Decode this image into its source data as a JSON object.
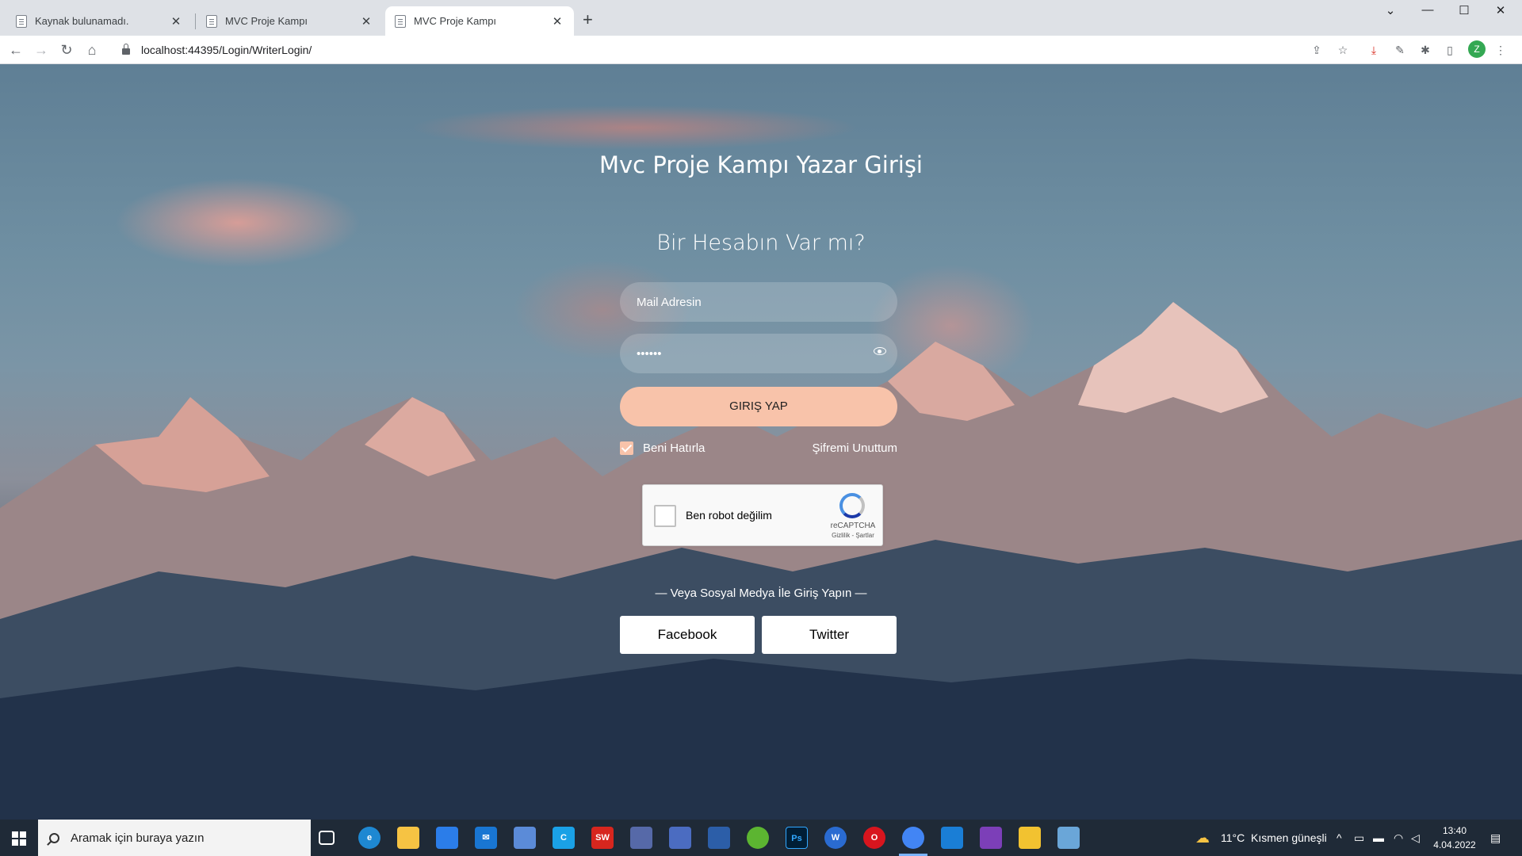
{
  "browser": {
    "tabs": [
      {
        "title": "Kaynak bulunamadı.",
        "active": false
      },
      {
        "title": "MVC Proje Kampı",
        "active": false
      },
      {
        "title": "MVC Proje Kampı",
        "active": true
      }
    ],
    "new_tab": "+",
    "url": "localhost:44395/Login/WriterLogin/",
    "profile_initial": "Z"
  },
  "login": {
    "title": "Mvc Proje Kampı Yazar Girişi",
    "subtitle": "Bir Hesabın Var mı?",
    "email_placeholder": "Mail Adresin",
    "password_value": "••••••",
    "submit_label": "GIRIŞ YAP",
    "remember_label": "Beni Hatırla",
    "remember_checked": true,
    "forgot_label": "Şifremi Unuttum",
    "captcha": {
      "label": "Ben robot değilim",
      "brand": "reCAPTCHA",
      "terms": "Gizlilik - Şartlar"
    },
    "social_text": "— Veya Sosyal Medya İle Giriş Yapın —",
    "facebook_label": "Facebook",
    "twitter_label": "Twitter",
    "accent_color": "#f8c3aa"
  },
  "taskbar": {
    "search_placeholder": "Aramak için buraya yazın",
    "apps": [
      "task-view",
      "edge",
      "file-explorer",
      "store",
      "mail",
      "app",
      "ccleaner",
      "solidworks",
      "network-app",
      "app-box",
      "calculator-app",
      "app-green",
      "photoshop",
      "wordpad",
      "opera",
      "chrome",
      "vscode",
      "visual-studio",
      "app-yellow",
      "notepad"
    ],
    "weather": {
      "temp": "11°C",
      "desc": "Kısmen güneşli"
    },
    "time": "13:40",
    "date": "4.04.2022"
  }
}
